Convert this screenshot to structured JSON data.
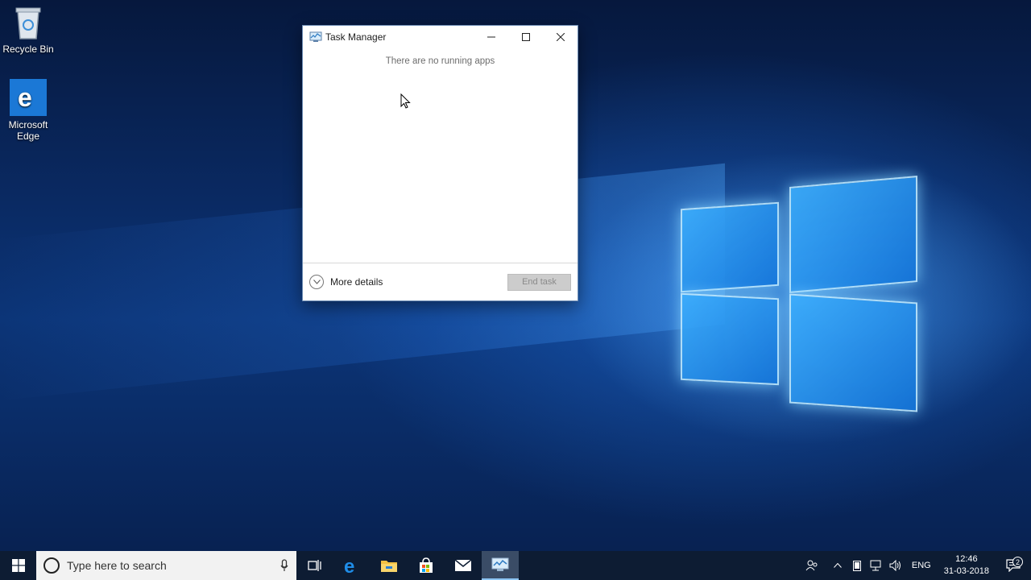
{
  "desktop": {
    "icons": [
      {
        "label": "Recycle Bin",
        "icon": "recycle-bin-icon"
      },
      {
        "label": "Microsoft Edge",
        "icon": "edge-icon"
      }
    ]
  },
  "task_manager": {
    "title": "Task Manager",
    "empty_message": "There are no running apps",
    "more_details_label": "More details",
    "end_task_label": "End task",
    "controls": [
      "minimize",
      "maximize",
      "close"
    ]
  },
  "taskbar": {
    "search_placeholder": "Type here to search",
    "apps": [
      "task-view-icon",
      "edge-icon",
      "file-explorer-icon",
      "store-icon",
      "mail-icon",
      "task-manager-icon"
    ],
    "active_app": "task-manager-icon",
    "tray": {
      "language": "ENG",
      "time": "12:46",
      "date": "31-03-2018",
      "notification_count": "2"
    }
  },
  "colors": {
    "accent": "#0078d7",
    "taskbar": "#0d1c33"
  }
}
